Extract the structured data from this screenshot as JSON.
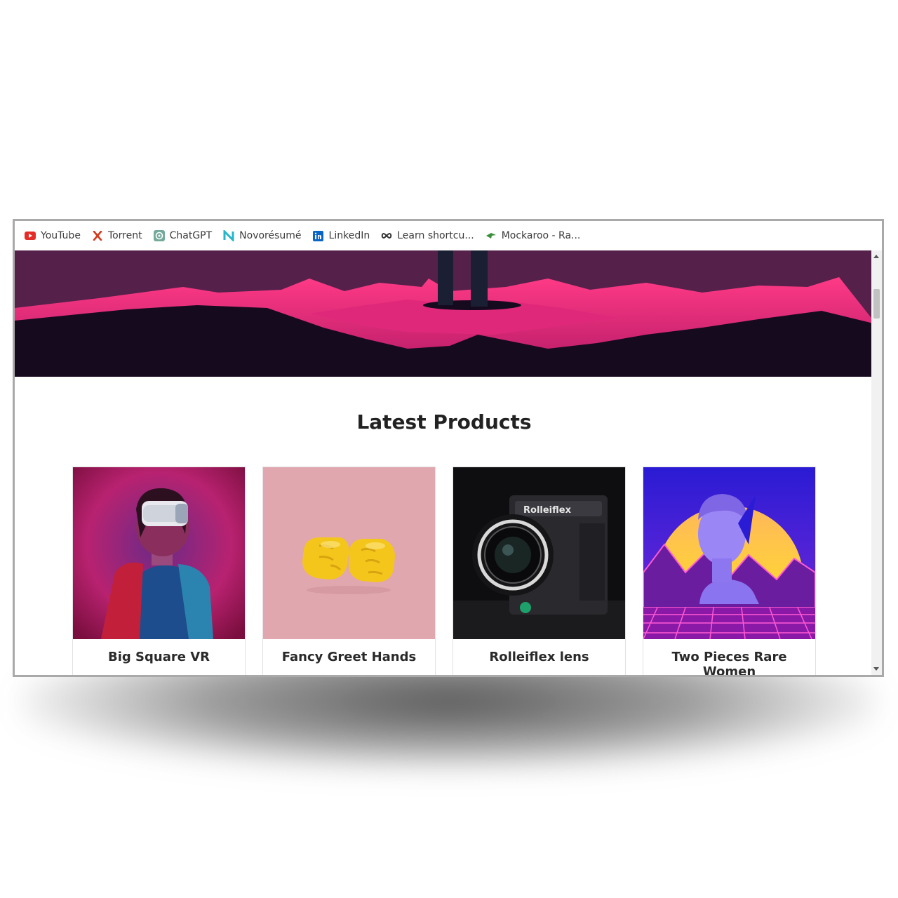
{
  "bookmarks": [
    {
      "label": "YouTube",
      "icon": "youtube-icon"
    },
    {
      "label": "Torrent",
      "icon": "torrent-icon"
    },
    {
      "label": "ChatGPT",
      "icon": "chatgpt-icon"
    },
    {
      "label": "Novorésumé",
      "icon": "novoresume-icon"
    },
    {
      "label": "LinkedIn",
      "icon": "linkedin-icon"
    },
    {
      "label": "Learn shortcu...",
      "icon": "infinity-icon"
    },
    {
      "label": "Mockaroo - Ra...",
      "icon": "mockaroo-icon"
    }
  ],
  "section": {
    "title": "Latest Products"
  },
  "products": [
    {
      "name": "Big Square VR",
      "image": "vr-headset-woman"
    },
    {
      "name": "Fancy Greet Hands",
      "image": "fist-bump-hands"
    },
    {
      "name": "Rolleiflex lens",
      "image": "rolleiflex-camera",
      "brand_text": "Rolleiflex"
    },
    {
      "name": "Two Pieces Rare Women",
      "image": "retro-statue-bust"
    }
  ],
  "colors": {
    "hero_bg": "#55204a",
    "hero_pink": "#e0287a",
    "hero_dark": "#160a1f",
    "card_pink": "#e0a7ae"
  }
}
